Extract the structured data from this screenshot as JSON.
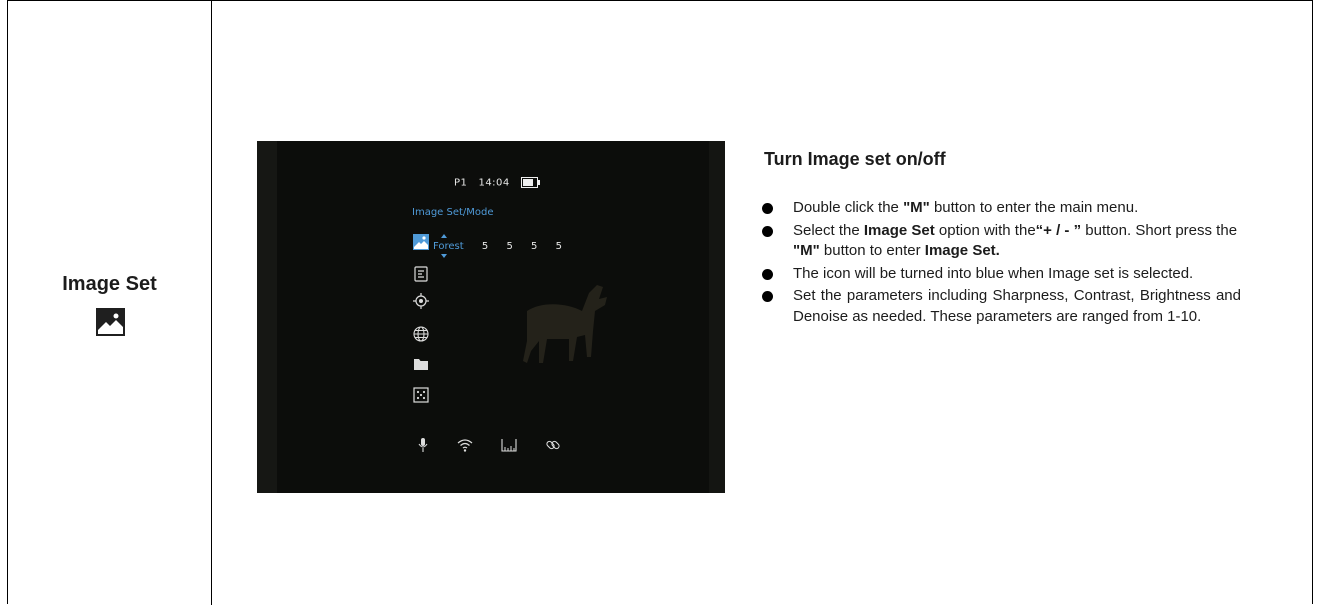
{
  "row": {
    "label": "Image Set",
    "label_icon": "image-set-icon"
  },
  "device_screen": {
    "status": {
      "preset": "P1",
      "time": "14:04"
    },
    "menu_title": "Image Set/Mode",
    "selected_mode": "Forest",
    "param_values": [
      "5",
      "5",
      "5",
      "5"
    ],
    "menu_icons": [
      "image-set-icon",
      "reticle-settings-icon",
      "crosshair-icon",
      "globe-icon",
      "folder-icon",
      "dice-icon"
    ],
    "bottom_icons": [
      "microphone-icon",
      "wifi-icon",
      "ruler-icon",
      "link-icon"
    ],
    "accent_color": "#4f9ad8"
  },
  "instructions": {
    "heading": "Turn Image set on/off",
    "b1": {
      "pre": "Double click the ",
      "m": "\"M\"",
      "post": " button to enter the main menu."
    },
    "b2": {
      "pre": "Select the ",
      "opt": "Image Set",
      "mid": " option with the",
      "keys": "“+ / - ”",
      "post": " button. Short press the ",
      "m": "\"M\"",
      "post2": " button to enter ",
      "target": "Image Set."
    },
    "b3": "The icon will be turned into blue when Image   set is selected.",
    "b4": "Set the parameters including Sharpness, Contrast, Brightness and Denoise as needed. These parameters are ranged from 1-10."
  }
}
